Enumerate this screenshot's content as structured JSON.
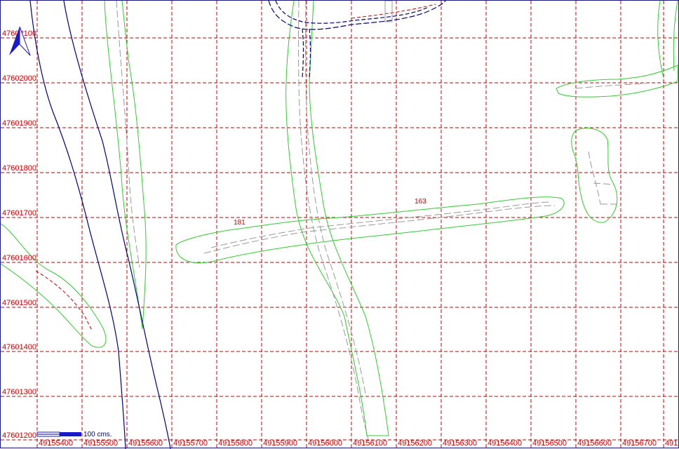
{
  "map": {
    "y_labels": [
      "47602100",
      "47602000",
      "47601900",
      "47601800",
      "47601700",
      "47601600",
      "47601500",
      "47601400",
      "47601300",
      "47601200"
    ],
    "x_labels": [
      "49155400",
      "49155500",
      "49155600",
      "49155700",
      "49155800",
      "49155900",
      "49156000",
      "49156100",
      "49156200",
      "49156300",
      "49156400",
      "49156500",
      "49156600",
      "49156700",
      "491"
    ],
    "parcel_labels": [
      "181",
      "163"
    ],
    "scale_bar": {
      "label": "100 cms."
    },
    "north_arrow": "north-arrow-icon",
    "colors": {
      "grid": "#cc0000",
      "parcel_outline": "#33cc33",
      "road_centerline": "#9a9a9a",
      "river": "#000080",
      "label": "#cc0000"
    }
  }
}
